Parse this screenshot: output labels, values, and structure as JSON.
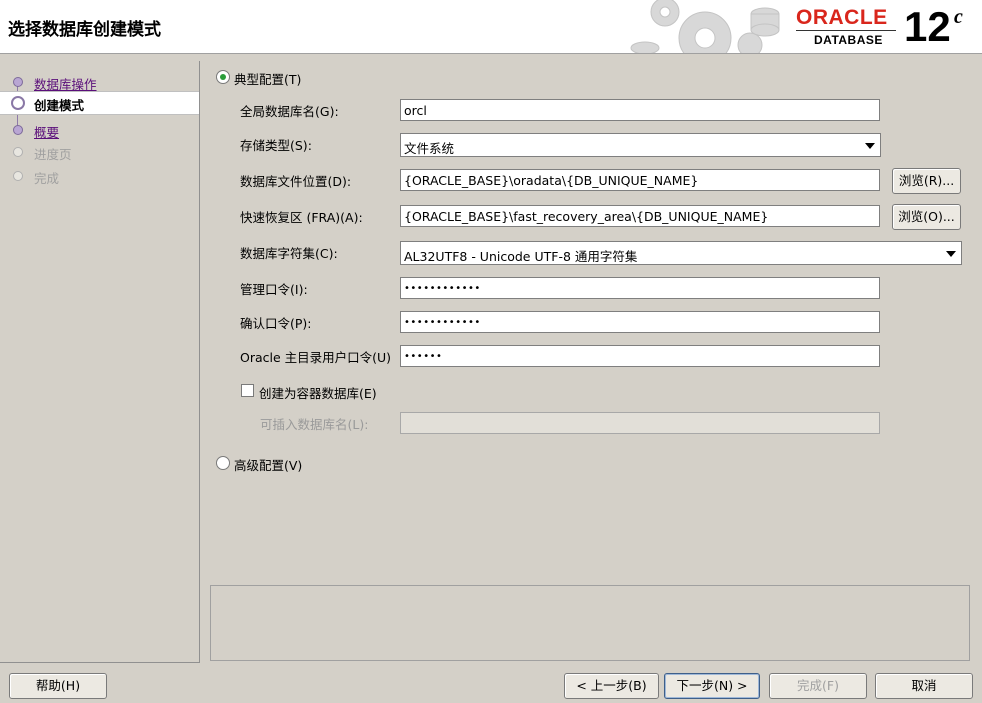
{
  "header": {
    "title": "选择数据库创建模式",
    "logo_brand": "ORACLE",
    "logo_product": "DATABASE",
    "logo_version": "12",
    "logo_version_suffix": "c"
  },
  "sidebar": {
    "items": [
      {
        "label": "数据库操作",
        "state": "visited"
      },
      {
        "label": "创建模式",
        "state": "current"
      },
      {
        "label": "概要",
        "state": "link"
      },
      {
        "label": "进度页",
        "state": "disabled"
      },
      {
        "label": "完成",
        "state": "disabled"
      }
    ]
  },
  "form": {
    "typical_label": "典型配置(T)",
    "typical_selected": true,
    "global_db_name_label": "全局数据库名(G):",
    "global_db_name_value": "orcl",
    "storage_type_label": "存储类型(S):",
    "storage_type_value": "文件系统",
    "db_file_location_label": "数据库文件位置(D):",
    "db_file_location_value": "{ORACLE_BASE}\\oradata\\{DB_UNIQUE_NAME}",
    "browse_r_label": "浏览(R)...",
    "fra_label": "快速恢复区 (FRA)(A):",
    "fra_value": "{ORACLE_BASE}\\fast_recovery_area\\{DB_UNIQUE_NAME}",
    "browse_o_label": "浏览(O)...",
    "charset_label": "数据库字符集(C):",
    "charset_value": "AL32UTF8 - Unicode UTF-8 通用字符集",
    "admin_pwd_label": "管理口令(I):",
    "admin_pwd_value": "••••••••••••",
    "confirm_pwd_label": "确认口令(P):",
    "confirm_pwd_value": "••••••••••••",
    "home_user_pwd_label": "Oracle 主目录用户口令(U)",
    "home_user_pwd_value": "••••••",
    "container_db_label": "创建为容器数据库(E)",
    "container_db_checked": false,
    "pdb_name_label": "可插入数据库名(L):",
    "pdb_name_value": "",
    "advanced_label": "高级配置(V)",
    "advanced_selected": false
  },
  "footer": {
    "help_label": "帮助(H)",
    "back_label": "< 上一步(B)",
    "next_label": "下一步(N) >",
    "finish_label": "完成(F)",
    "cancel_label": "取消"
  },
  "colors": {
    "window_bg": "#d4d0c8",
    "oracle_red": "#d9261c",
    "nav_link": "#5a0e7a",
    "radio_selected": "#2a9d3a"
  }
}
